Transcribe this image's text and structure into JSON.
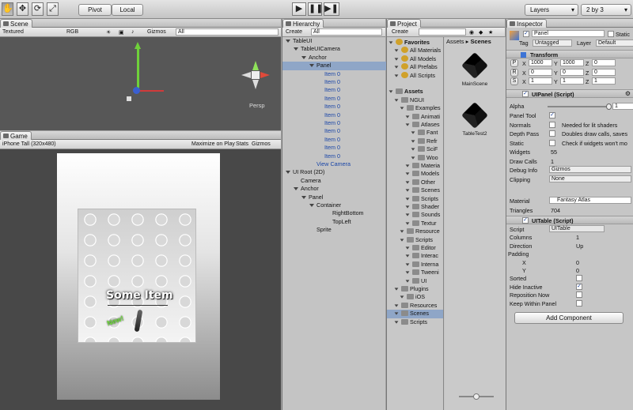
{
  "toolbar": {
    "pivot": "Pivot",
    "local": "Local",
    "layers": "Layers",
    "layout": "2 by 3"
  },
  "scene": {
    "tab": "Scene",
    "render_mode": "Textured",
    "color": "RGB",
    "gizmos": "Gizmos",
    "search": "All",
    "persp": "Persp"
  },
  "game": {
    "tab": "Game",
    "resolution": "iPhone Tall (320x480)",
    "maximize": "Maximize on Play",
    "stats": "Stats",
    "gizmos": "Gizmos",
    "item_label": "Some Item",
    "new_badge": "New!"
  },
  "hierarchy": {
    "tab": "Hierarchy",
    "create": "Create",
    "search": "All",
    "rows": [
      {
        "label": "TableUI",
        "indent": 0,
        "type": "node"
      },
      {
        "label": "TableUICamera",
        "indent": 1,
        "type": "node"
      },
      {
        "label": "Anchor",
        "indent": 2,
        "type": "node"
      },
      {
        "label": "Panel",
        "indent": 3,
        "type": "selected"
      },
      {
        "label": "Item 0",
        "indent": 4,
        "type": "blue"
      },
      {
        "label": "Item 0",
        "indent": 4,
        "type": "blue"
      },
      {
        "label": "Item 0",
        "indent": 4,
        "type": "blue"
      },
      {
        "label": "Item 0",
        "indent": 4,
        "type": "blue"
      },
      {
        "label": "Item 0",
        "indent": 4,
        "type": "blue"
      },
      {
        "label": "Item 0",
        "indent": 4,
        "type": "blue"
      },
      {
        "label": "Item 0",
        "indent": 4,
        "type": "blue"
      },
      {
        "label": "Item 0",
        "indent": 4,
        "type": "blue"
      },
      {
        "label": "Item 0",
        "indent": 4,
        "type": "blue"
      },
      {
        "label": "Item 0",
        "indent": 4,
        "type": "blue"
      },
      {
        "label": "Item 0",
        "indent": 4,
        "type": "blue"
      },
      {
        "label": "View Camera",
        "indent": 3,
        "type": "bluelabel"
      },
      {
        "label": "UI Root (2D)",
        "indent": 0,
        "type": "node"
      },
      {
        "label": "Camera",
        "indent": 1,
        "type": "plain"
      },
      {
        "label": "Anchor",
        "indent": 1,
        "type": "node"
      },
      {
        "label": "Panel",
        "indent": 2,
        "type": "node"
      },
      {
        "label": "Container",
        "indent": 3,
        "type": "node"
      },
      {
        "label": "RightBottom",
        "indent": 5,
        "type": "plain"
      },
      {
        "label": "TopLeft",
        "indent": 5,
        "type": "plain"
      },
      {
        "label": "Sprite",
        "indent": 3,
        "type": "plain"
      }
    ]
  },
  "project": {
    "tab": "Project",
    "create": "Create",
    "breadcrumb_root": "Assets",
    "breadcrumb_sep": "▸",
    "breadcrumb_leaf": "Scenes",
    "tree": [
      {
        "label": "Favorites",
        "indent": 0,
        "icon": "star",
        "bold": true
      },
      {
        "label": "All Materials",
        "indent": 1,
        "icon": "star"
      },
      {
        "label": "All Models",
        "indent": 1,
        "icon": "star"
      },
      {
        "label": "All Prefabs",
        "indent": 1,
        "icon": "star"
      },
      {
        "label": "All Scripts",
        "indent": 1,
        "icon": "star"
      },
      {
        "label": "",
        "indent": 0,
        "icon": "none"
      },
      {
        "label": "Assets",
        "indent": 0,
        "icon": "folder",
        "bold": true
      },
      {
        "label": "NGUI",
        "indent": 1,
        "icon": "folder"
      },
      {
        "label": "Examples",
        "indent": 2,
        "icon": "folder"
      },
      {
        "label": "Animati",
        "indent": 3,
        "icon": "folder"
      },
      {
        "label": "Atlases",
        "indent": 3,
        "icon": "folder"
      },
      {
        "label": "Fant",
        "indent": 4,
        "icon": "folder"
      },
      {
        "label": "Refr",
        "indent": 4,
        "icon": "folder"
      },
      {
        "label": "SciF",
        "indent": 4,
        "icon": "folder"
      },
      {
        "label": "Woo",
        "indent": 4,
        "icon": "folder"
      },
      {
        "label": "Materia",
        "indent": 3,
        "icon": "folder"
      },
      {
        "label": "Models",
        "indent": 3,
        "icon": "folder"
      },
      {
        "label": "Other",
        "indent": 3,
        "icon": "folder"
      },
      {
        "label": "Scenes",
        "indent": 3,
        "icon": "folder"
      },
      {
        "label": "Scripts",
        "indent": 3,
        "icon": "folder"
      },
      {
        "label": "Shader",
        "indent": 3,
        "icon": "folder"
      },
      {
        "label": "Sounds",
        "indent": 3,
        "icon": "folder"
      },
      {
        "label": "Textur",
        "indent": 3,
        "icon": "folder"
      },
      {
        "label": "Resource",
        "indent": 2,
        "icon": "folder"
      },
      {
        "label": "Scripts",
        "indent": 2,
        "icon": "folder"
      },
      {
        "label": "Editor",
        "indent": 3,
        "icon": "folder"
      },
      {
        "label": "Interac",
        "indent": 3,
        "icon": "folder"
      },
      {
        "label": "Interna",
        "indent": 3,
        "icon": "folder"
      },
      {
        "label": "Tweeni",
        "indent": 3,
        "icon": "folder"
      },
      {
        "label": "UI",
        "indent": 3,
        "icon": "folder"
      },
      {
        "label": "Plugins",
        "indent": 1,
        "icon": "folder"
      },
      {
        "label": "iOS",
        "indent": 2,
        "icon": "folder"
      },
      {
        "label": "Resources",
        "indent": 1,
        "icon": "folder"
      },
      {
        "label": "Scenes",
        "indent": 1,
        "icon": "folder",
        "selected": true
      },
      {
        "label": "Scripts",
        "indent": 1,
        "icon": "folder"
      }
    ],
    "assets": [
      {
        "label": "MainScene"
      },
      {
        "label": "TableTest2"
      }
    ]
  },
  "inspector": {
    "tab": "Inspector",
    "object_name": "Panel",
    "static": "Static",
    "tag_label": "Tag",
    "tag_value": "Untagged",
    "layer_label": "Layer",
    "layer_value": "Default",
    "transform": {
      "title": "Transform",
      "p": "P",
      "r": "R",
      "s": "S",
      "pos": [
        "1000",
        "1000",
        "0"
      ],
      "rot": [
        "0",
        "0",
        "0"
      ],
      "scale": [
        "1",
        "1",
        "1"
      ]
    },
    "uipanel": {
      "title": "UIPanel (Script)",
      "alpha_label": "Alpha",
      "alpha_value": "1",
      "alpha_level": 1,
      "rows": [
        {
          "label": "Panel Tool",
          "check": true,
          "note": ""
        },
        {
          "label": "Normals",
          "check": false,
          "note": "Needed for lit shaders"
        },
        {
          "label": "Depth Pass",
          "check": false,
          "note": "Doubles draw calls, saves"
        },
        {
          "label": "Static",
          "check": false,
          "note": "Check if widgets won't mo"
        }
      ],
      "widgets_label": "Widgets",
      "widgets": "55",
      "drawcalls_label": "Draw Calls",
      "drawcalls": "1",
      "debug_label": "Debug Info",
      "debug": "Gizmos",
      "clipping_label": "Clipping",
      "clipping": "None"
    },
    "material_label": "Material",
    "material_value": "Fantasy Atlas",
    "triangles_label": "Triangles",
    "triangles": "704",
    "uitable": {
      "title": "UITable (Script)",
      "script_label": "Script",
      "script_value": "UITable",
      "columns_label": "Columns",
      "columns": "1",
      "direction_label": "Direction",
      "direction": "Up",
      "padding_label": "Padding",
      "x_label": "X",
      "x": "0",
      "y_label": "Y",
      "y": "0",
      "checks": [
        {
          "label": "Sorted",
          "check": false
        },
        {
          "label": "Hide Inactive",
          "check": true
        },
        {
          "label": "Reposition Now",
          "check": false
        },
        {
          "label": "Keep Within Panel",
          "check": false
        }
      ]
    },
    "add_component": "Add Component"
  }
}
